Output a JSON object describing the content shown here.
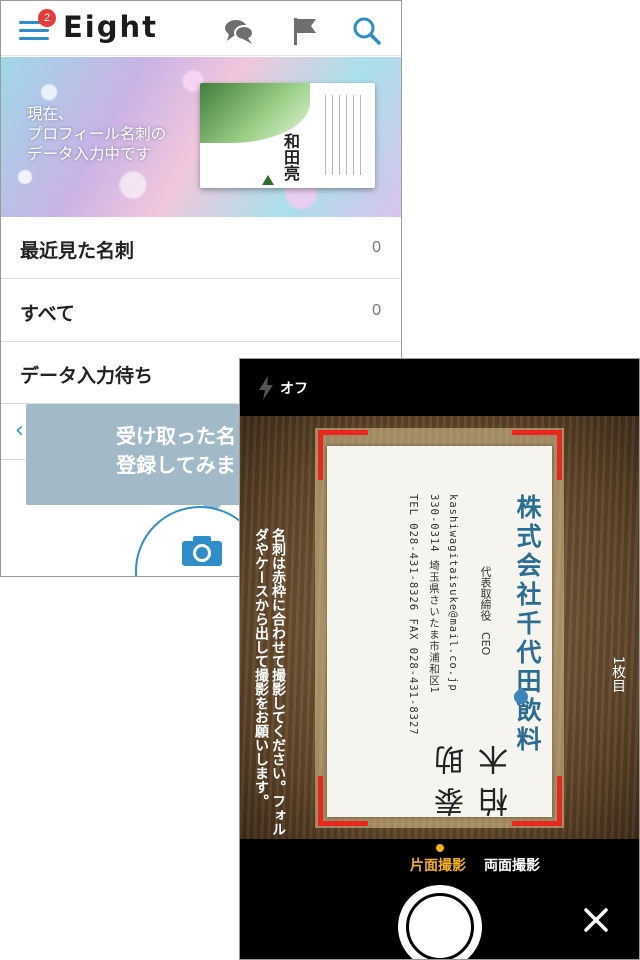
{
  "eight_app": {
    "menu": {
      "badge": "2"
    },
    "title": "Eight",
    "header_icons": [
      "chat-icon",
      "flag-icon",
      "search-icon"
    ],
    "accent": "#2f8ec8",
    "banner": {
      "text": "現在、\nプロフィール名刺の\nデータ入力中です",
      "card_name": "和田亮"
    },
    "list": [
      {
        "label": "最近見た名刺",
        "count": "0"
      },
      {
        "label": "すべて",
        "count": "0"
      },
      {
        "label": "データ入力待ち",
        "count": ""
      }
    ],
    "tooltip": {
      "text": "受け取った名\n登録してみま"
    }
  },
  "camera": {
    "flash": {
      "icon": "flash-icon",
      "label": "オフ"
    },
    "instruction": "名刺は赤枠に合わせて撮影してください。フォルダやケースから出して撮影をお願いします。",
    "count": "1枚目",
    "card": {
      "company": "株式会社千代田飲料",
      "person": "柏木泰助",
      "title": "代表取締役　CEO",
      "email": "kashiwagitaisuke@mail.co.jp",
      "address": "330-0314 埼玉県さいたま市浦和区1",
      "phone": "TEL 028-431-8326 FAX 028-431-8327"
    },
    "modes": {
      "single": "片面撮影",
      "double": "両面撮影"
    },
    "frame_color": "#e8281f",
    "active_color": "#f2b21f"
  }
}
